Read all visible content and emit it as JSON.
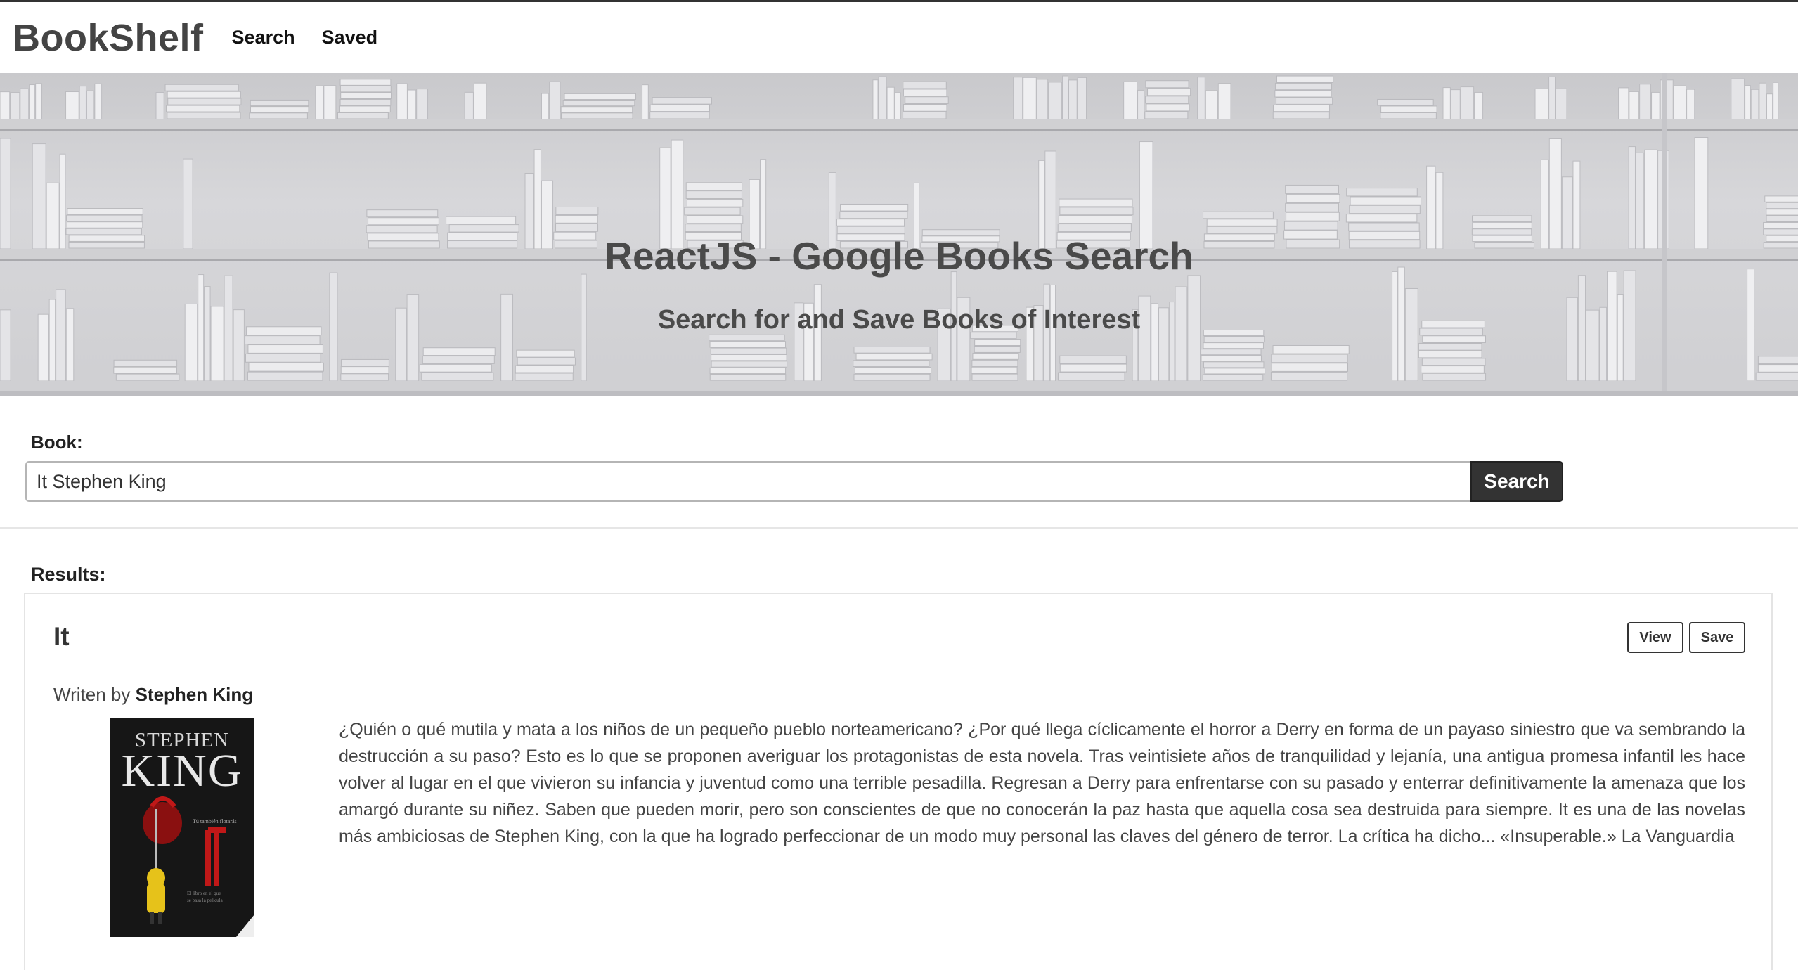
{
  "navbar": {
    "brand": "BookShelf",
    "links": [
      {
        "label": "Search"
      },
      {
        "label": "Saved"
      }
    ]
  },
  "hero": {
    "title": "ReactJS - Google Books Search",
    "subtitle": "Search for and Save Books of Interest"
  },
  "search": {
    "label": "Book:",
    "value": "It Stephen King",
    "button_label": "Search"
  },
  "results": {
    "label": "Results:",
    "items": [
      {
        "title": "It",
        "written_prefix": "Writen by",
        "author": "Stephen King",
        "view_label": "View",
        "save_label": "Save",
        "cover_author": "STEPHEN",
        "cover_name": "KING",
        "description": "¿Quién o qué mutila y mata a los niños de un pequeño pueblo norteamericano? ¿Por qué llega cíclicamente el horror a Derry en forma de un payaso siniestro que va sembrando la destrucción a su paso? Esto es lo que se proponen averiguar los protagonistas de esta novela. Tras veintisiete años de tranquilidad y lejanía, una antigua promesa infantil les hace volver al lugar en el que vivieron su infancia y juventud como una terrible pesadilla. Regresan a Derry para enfrentarse con su pasado y enterrar definitivamente la amenaza que los amargó durante su niñez. Saben que pueden morir, pero son conscientes de que no conocerán la paz hasta que aquella cosa sea destruida para siempre. It es una de las novelas más ambiciosas de Stephen King, con la que ha logrado perfeccionar de un modo muy personal las claves del género de terror. La crítica ha dicho... «Insuperable.» La Vanguardia"
      }
    ]
  }
}
